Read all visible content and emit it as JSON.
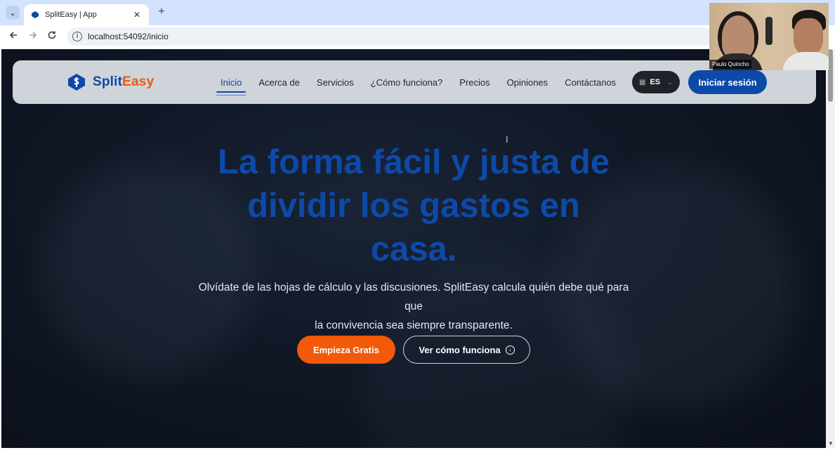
{
  "browser": {
    "tab_title": "SplitEasy | App",
    "url": "localhost:54092/inicio",
    "back_icon": "arrow-left-icon",
    "forward_icon": "arrow-right-icon",
    "reload_icon": "reload-icon",
    "new_tab_symbol": "+",
    "close_symbol": "✕"
  },
  "site": {
    "logo_split": "Split",
    "logo_easy": "Easy",
    "nav": [
      "Inicio",
      "Acerca de",
      "Servicios",
      "¿Cómo funciona?",
      "Precios",
      "Opiniones",
      "Contáctanos"
    ],
    "active_nav": "Inicio",
    "language": "ES",
    "login_label": "Iniciar sesión",
    "colors": {
      "brand_blue": "#0d4aa8",
      "brand_orange": "#f25a0a"
    }
  },
  "hero": {
    "title_line1": "La forma fácil y justa de",
    "title_line2": "dividir los gastos en",
    "title_line3": "casa.",
    "subtitle_line1": "Olvídate de las hojas de cálculo y las discusiones. SplitEasy calcula quién debe qué para que",
    "subtitle_line2": "la convivencia sea siempre transparente.",
    "primary_button": "Empieza Gratis",
    "secondary_button": "Ver cómo funciona"
  },
  "video_call": {
    "participant_name": "Paulo Quincho"
  }
}
